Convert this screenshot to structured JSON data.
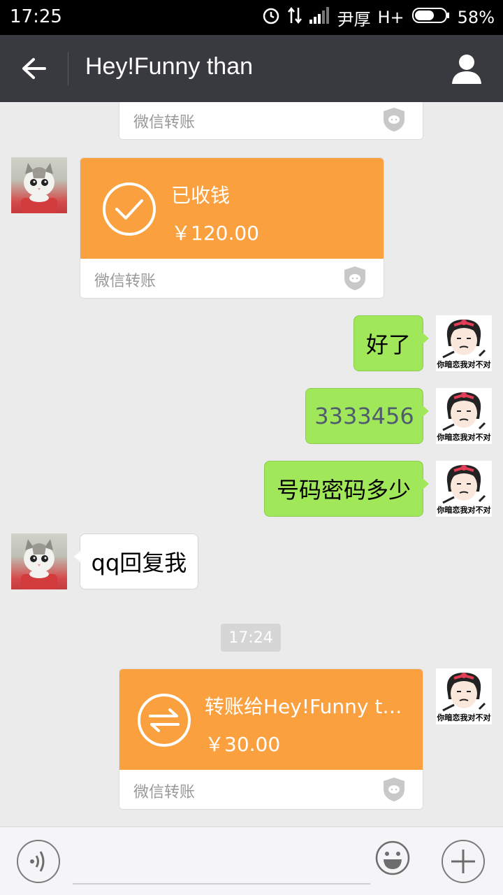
{
  "status_bar": {
    "time": "17:25",
    "carrier": "尹厚",
    "network": "H+",
    "battery": "58%"
  },
  "header": {
    "title": "Hey!Funny than"
  },
  "messages": {
    "top_transfer_label": "微信转账",
    "received": {
      "title": "已收钱",
      "amount": "￥120.00",
      "label": "微信转账"
    },
    "sent1": "好了",
    "sent2": "3333456",
    "sent3": "号码密码多少",
    "recv_text": "qq回复我",
    "timestamp": "17:24",
    "outgoing_transfer": {
      "title": "转账给Hey!Funny t…",
      "amount": "￥30.00",
      "label": "微信转账"
    },
    "meme_caption": "你暗恋我对不对"
  },
  "colors": {
    "transfer_orange": "#faa03e",
    "bubble_green": "#a0e75a",
    "header_bg": "#393a3f"
  }
}
